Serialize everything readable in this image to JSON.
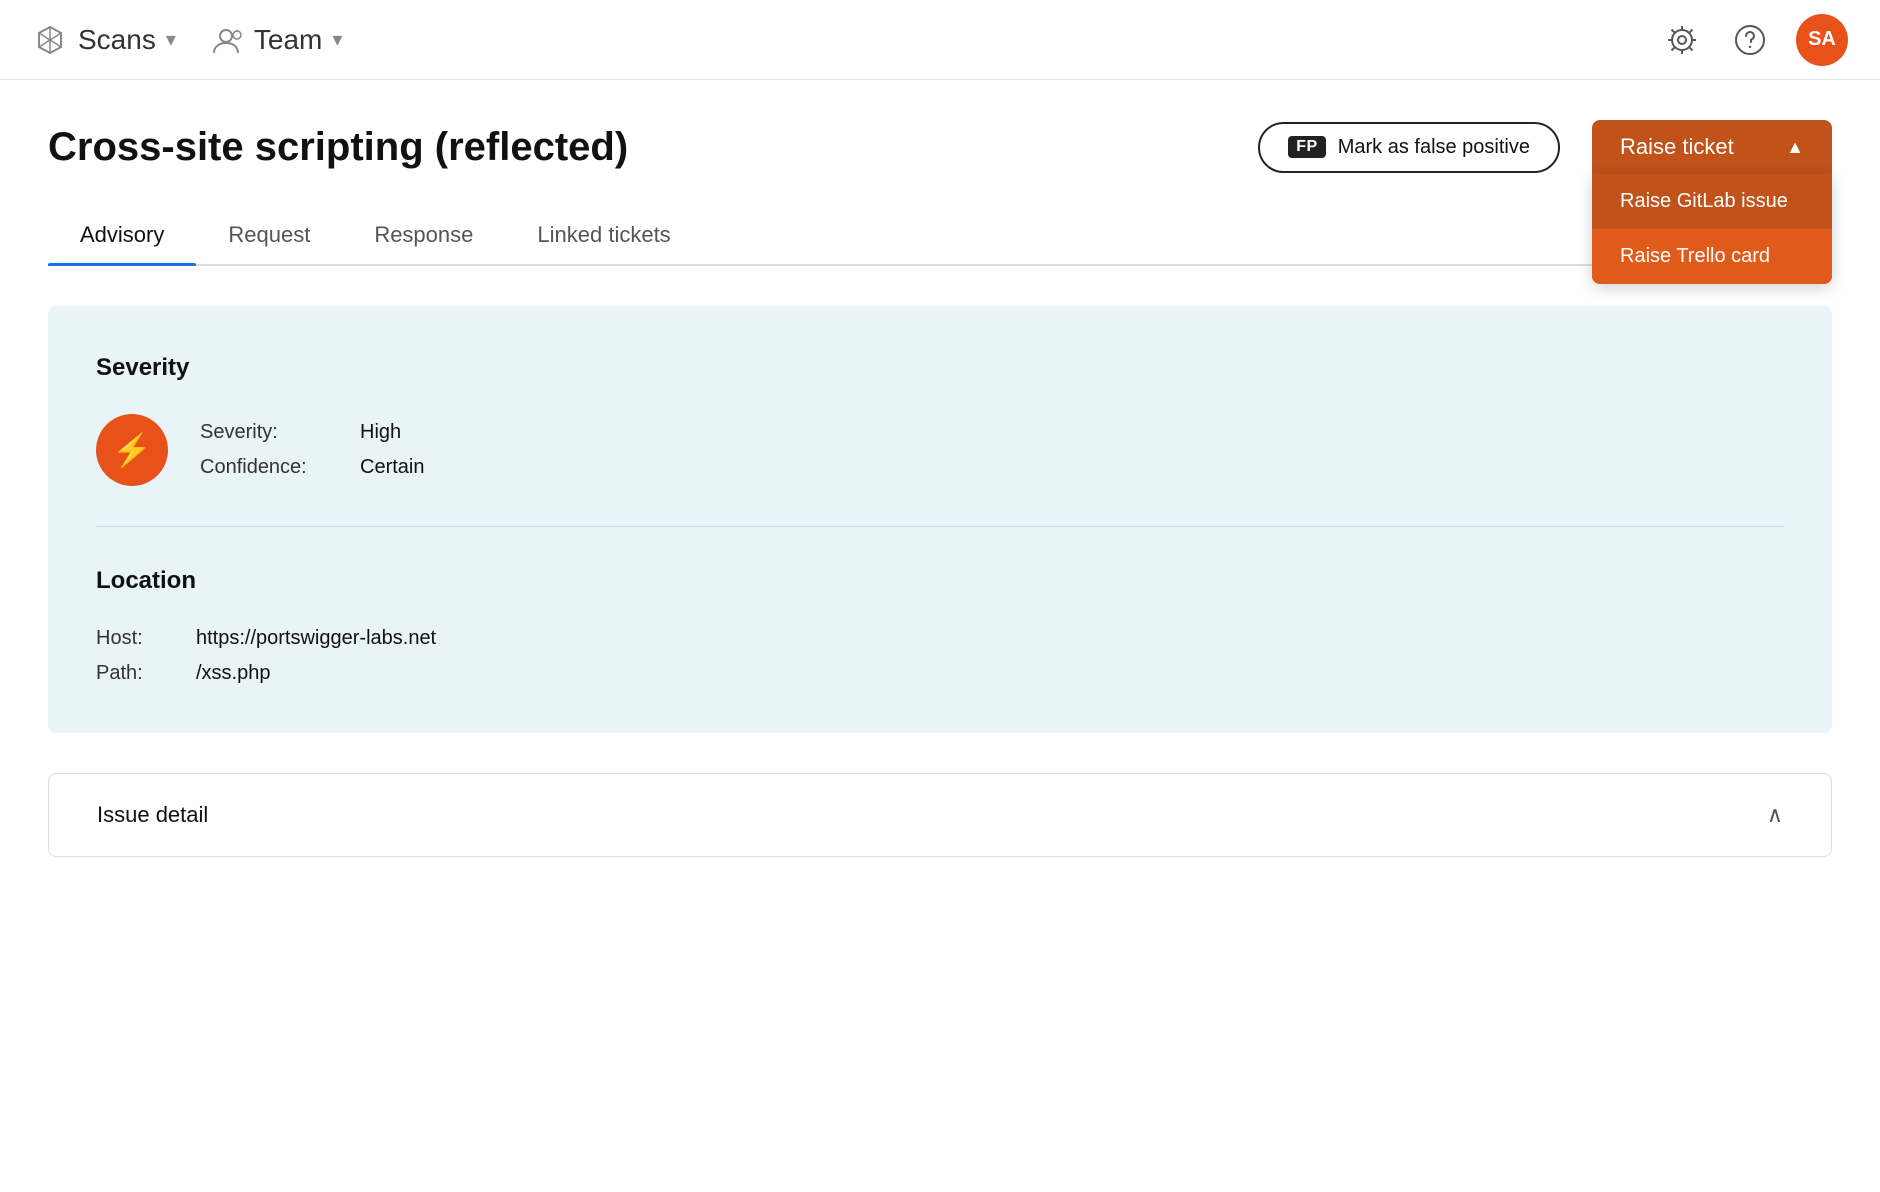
{
  "header": {
    "scans_label": "Scans",
    "team_label": "Team",
    "avatar_initials": "SA",
    "avatar_color": "#e8521a"
  },
  "page": {
    "title": "Cross-site scripting (reflected)",
    "false_positive_btn": {
      "badge": "FP",
      "label": "Mark as false positive"
    },
    "raise_ticket": {
      "label": "Raise ticket",
      "items": [
        {
          "id": "gitlab",
          "label": "Raise GitLab issue"
        },
        {
          "id": "trello",
          "label": "Raise Trello card"
        }
      ]
    }
  },
  "tabs": [
    {
      "id": "advisory",
      "label": "Advisory",
      "active": true
    },
    {
      "id": "request",
      "label": "Request"
    },
    {
      "id": "response",
      "label": "Response"
    },
    {
      "id": "linked",
      "label": "Linked tickets"
    }
  ],
  "severity": {
    "section_title": "Severity",
    "severity_label": "Severity:",
    "severity_value": "High",
    "confidence_label": "Confidence:",
    "confidence_value": "Certain",
    "icon_symbol": "⚡"
  },
  "location": {
    "section_title": "Location",
    "host_label": "Host:",
    "host_value": "https://portswigger-labs.net",
    "path_label": "Path:",
    "path_value": "/xss.php"
  },
  "issue_detail": {
    "title": "Issue detail"
  }
}
